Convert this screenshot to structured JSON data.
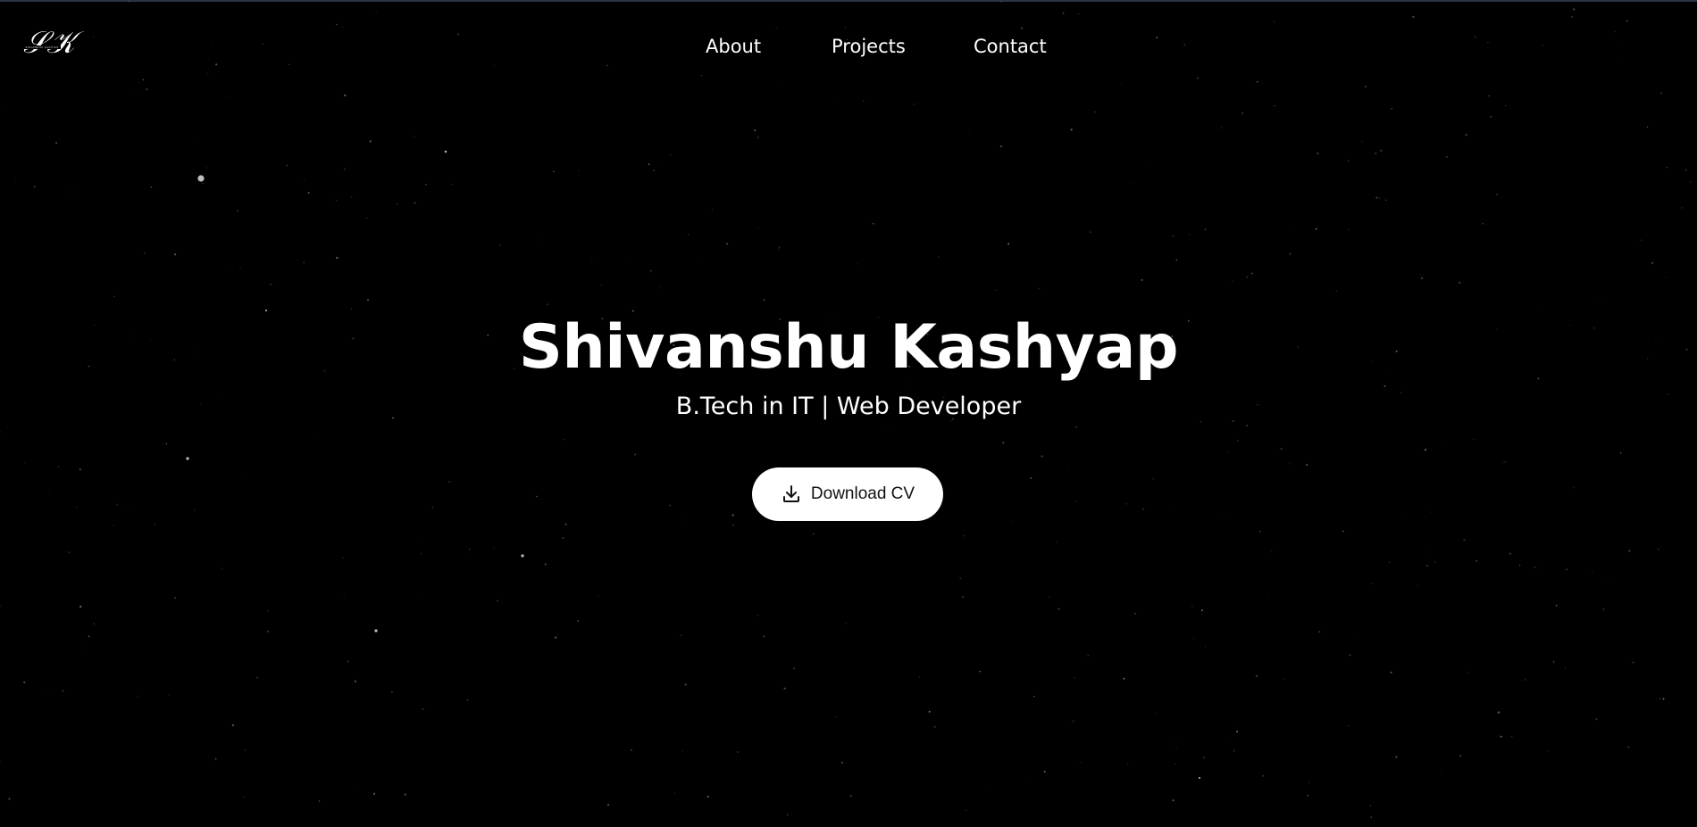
{
  "header": {
    "logo": {
      "mark": "SK",
      "caption": "SHIVANSHU KASHYAP",
      "icon": "monogram-logo"
    },
    "nav": [
      {
        "label": "About"
      },
      {
        "label": "Projects"
      },
      {
        "label": "Contact"
      }
    ]
  },
  "hero": {
    "title": "Shivanshu Kashyap",
    "subtitle": "B.Tech in IT | Web Developer",
    "cta": {
      "label": "Download CV",
      "icon": "download-icon"
    }
  },
  "theme": {
    "background": "#000000",
    "text": "#ffffff",
    "button_bg": "#ffffff",
    "button_text": "#111111",
    "top_rule": "#2b3447"
  }
}
